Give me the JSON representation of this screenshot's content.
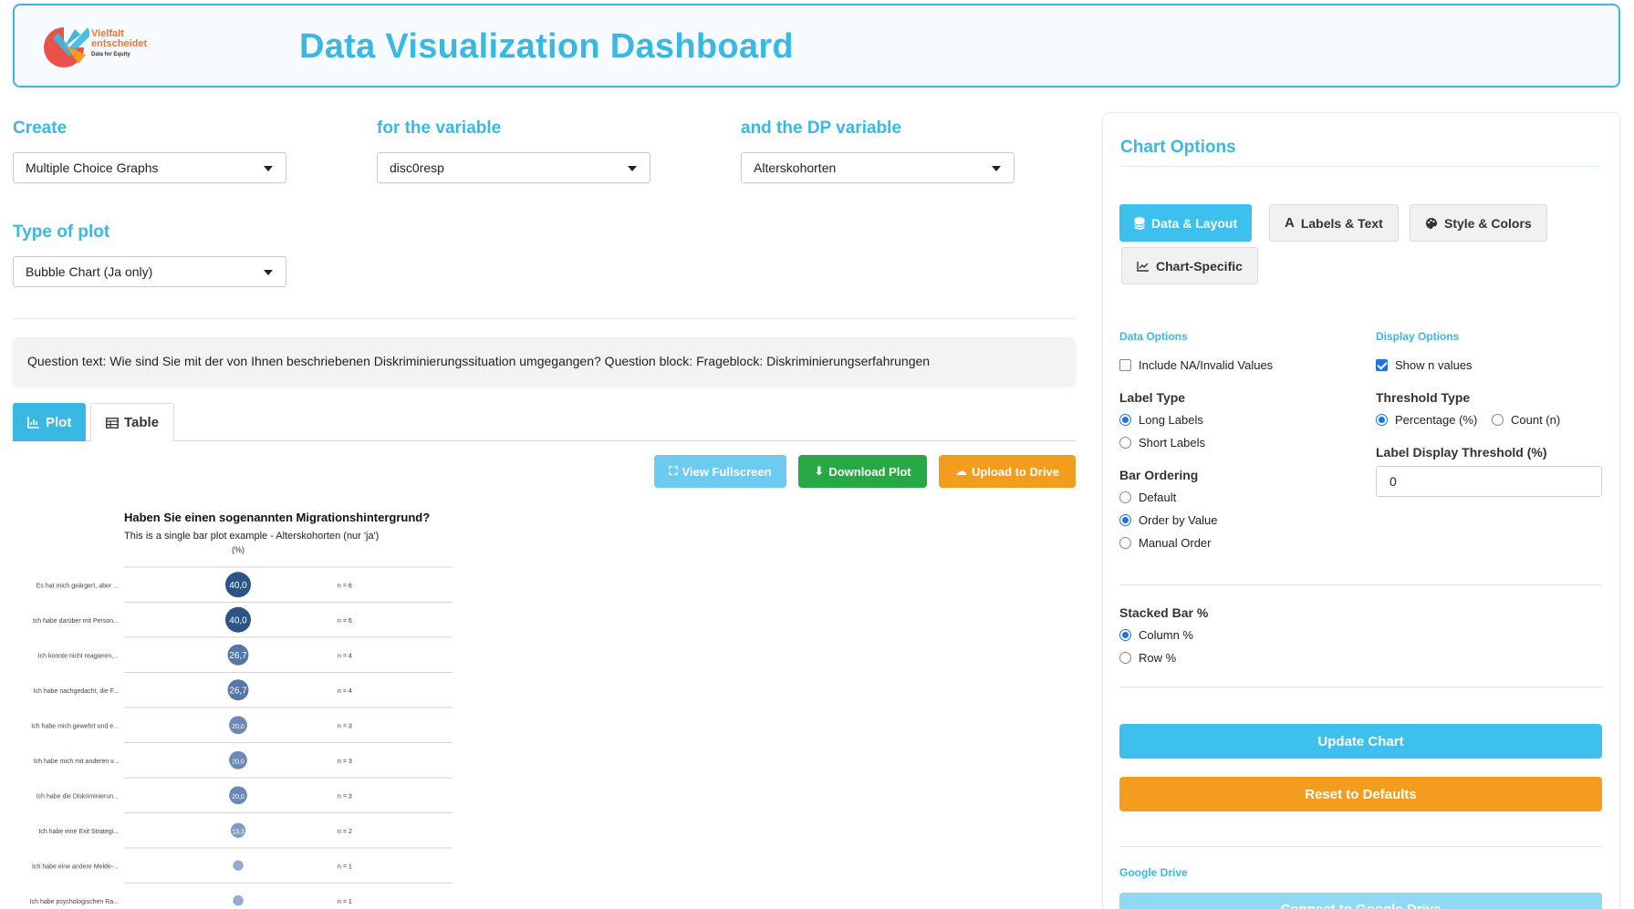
{
  "header": {
    "logo_line1": "Vielfalt",
    "logo_line2": "entscheidet",
    "logo_line3": "Data for Equity",
    "title": "Data Visualization Dashboard"
  },
  "selectors": {
    "create_label": "Create",
    "create_value": "Multiple Choice Graphs",
    "variable_label": "for the variable",
    "variable_value": "disc0resp",
    "dp_label": "and the DP variable",
    "dp_value": "Alterskohorten",
    "plot_type_label": "Type of plot",
    "plot_type_value": "Bubble Chart (Ja only)"
  },
  "question_text": "Question text: Wie sind Sie mit der von Ihnen beschriebenen Diskriminierungssituation umgegangen? Question block: Frageblock: Diskriminierungserfahrungen",
  "tabs": {
    "plot": "Plot",
    "table": "Table"
  },
  "actions": {
    "fullscreen": "View Fullscreen",
    "download": "Download Plot",
    "upload": "Upload to Drive"
  },
  "chart_data": {
    "type": "bubble",
    "title": "Haben Sie einen sogenannten Migrationshintergrund?",
    "subtitle": "This is a single bar plot example - Alterskohorten (nur 'ja')",
    "column_label": "(%)",
    "rows": [
      {
        "label": "Es hat mich geärgert, aber ...",
        "value": 40.0,
        "value_label": "40,0",
        "n": "n = 6"
      },
      {
        "label": "Ich habe darüber mit Person...",
        "value": 40.0,
        "value_label": "40,0",
        "n": "n = 6"
      },
      {
        "label": "Ich konnte nicht reagieren,...",
        "value": 26.7,
        "value_label": "26,7",
        "n": "n = 4"
      },
      {
        "label": "Ich habe nachgedacht, die F...",
        "value": 26.7,
        "value_label": "26,7",
        "n": "n = 4"
      },
      {
        "label": "Ich habe mich gewehrt und e...",
        "value": 20.0,
        "value_label": "20,0",
        "n": "n = 3"
      },
      {
        "label": "Ich habe mich mit anderen v...",
        "value": 20.0,
        "value_label": "20,0",
        "n": "n = 3"
      },
      {
        "label": "Ich habe die Diskriminierun...",
        "value": 20.0,
        "value_label": "20,0",
        "n": "n = 3"
      },
      {
        "label": "Ich habe eine Exit Strategi...",
        "value": 13.3,
        "value_label": "13,3",
        "n": "n = 2"
      },
      {
        "label": "Ich habe eine andere Melde-...",
        "value": 6.7,
        "value_label": "",
        "n": "n = 1"
      },
      {
        "label": "Ich habe psychologischen Ra...",
        "value": 6.7,
        "value_label": "",
        "n": "n = 1"
      }
    ],
    "max_value": 40.0
  },
  "panel": {
    "title": "Chart Options",
    "tabs": {
      "data_layout": "Data & Layout",
      "labels_text": "Labels & Text",
      "style_colors": "Style & Colors",
      "chart_specific": "Chart-Specific"
    },
    "data_options": "Data Options",
    "include_na": "Include NA/Invalid Values",
    "label_type": "Label Type",
    "long_labels": "Long Labels",
    "short_labels": "Short Labels",
    "bar_ordering": "Bar Ordering",
    "order_default": "Default",
    "order_value": "Order by Value",
    "order_manual": "Manual Order",
    "display_options": "Display Options",
    "show_n": "Show n values",
    "threshold_type": "Threshold Type",
    "threshold_pct": "Percentage (%)",
    "threshold_count": "Count (n)",
    "label_threshold": "Label Display Threshold (%)",
    "label_threshold_value": "0",
    "stacked_bar": "Stacked Bar %",
    "column_pct": "Column %",
    "row_pct": "Row %",
    "update": "Update Chart",
    "reset": "Reset to Defaults",
    "google_drive": "Google Drive",
    "connect_drive": "Connect to Google Drive"
  },
  "colors": {
    "accent": "#3ab8e4",
    "green": "#28a745",
    "orange": "#f39c1e",
    "light_blue": "#6ecbf0"
  }
}
